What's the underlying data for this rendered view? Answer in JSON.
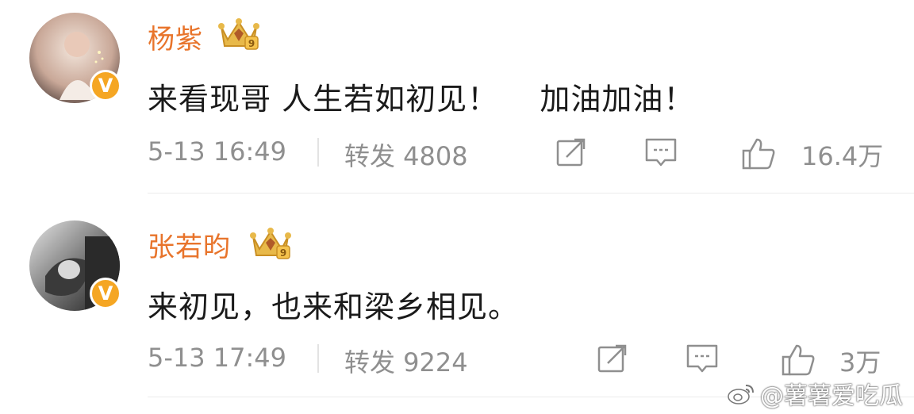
{
  "comments": [
    {
      "username": "杨紫",
      "text": "来看现哥 人生若如初见！    加油加油！",
      "time": "5-13 16:49",
      "repost": "转发 4808",
      "likes": "16.4万",
      "verified_badge": "V"
    },
    {
      "username": "张若昀",
      "text": "来初见，也来和梁乡相见。",
      "time": "5-13 17:49",
      "repost": "转发 9224",
      "likes": "3万",
      "verified_badge": "V"
    }
  ],
  "watermark": {
    "text": "@薯薯爱吃瓜",
    "icon": "weibo-logo-icon"
  },
  "colors": {
    "username": "#e8742b",
    "meta_text": "#8f8f8f",
    "verified_badge": "#f5a623",
    "crown_gold": "#e8b94a"
  },
  "icons": [
    "share-icon",
    "comment-icon",
    "like-icon",
    "vip-crown-icon"
  ]
}
